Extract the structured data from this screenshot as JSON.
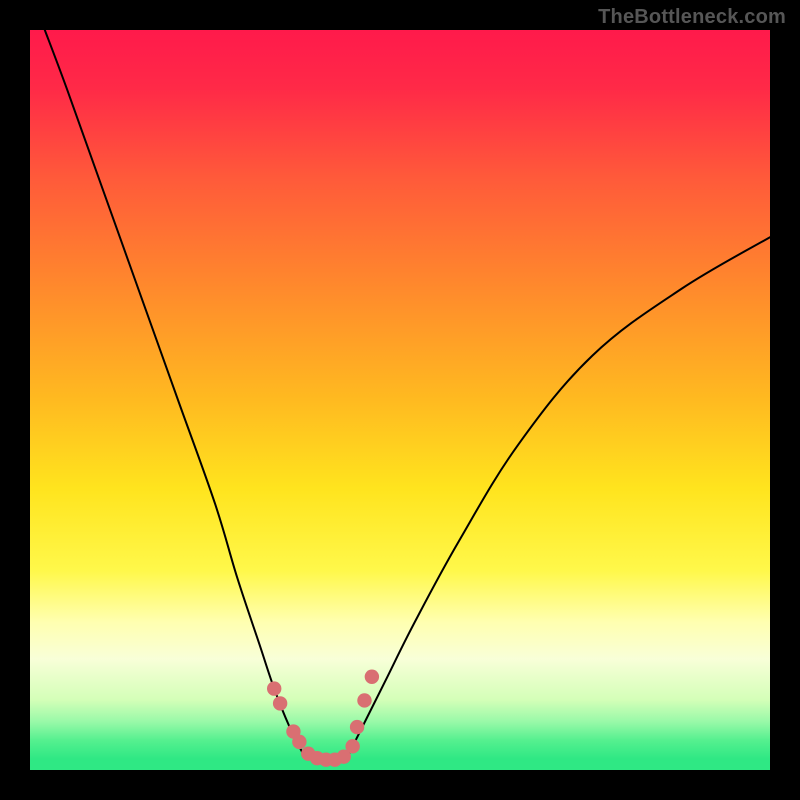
{
  "watermark": {
    "text": "TheBottleneck.com"
  },
  "gradient": {
    "stops": [
      {
        "offset": 0.0,
        "color": "#ff1a4b"
      },
      {
        "offset": 0.08,
        "color": "#ff2a47"
      },
      {
        "offset": 0.2,
        "color": "#ff5a3a"
      },
      {
        "offset": 0.35,
        "color": "#ff8a2c"
      },
      {
        "offset": 0.5,
        "color": "#ffba20"
      },
      {
        "offset": 0.62,
        "color": "#ffe41e"
      },
      {
        "offset": 0.73,
        "color": "#fff84a"
      },
      {
        "offset": 0.8,
        "color": "#ffffb0"
      },
      {
        "offset": 0.85,
        "color": "#f8ffd8"
      },
      {
        "offset": 0.905,
        "color": "#d4ffb8"
      },
      {
        "offset": 0.935,
        "color": "#98f9a8"
      },
      {
        "offset": 0.96,
        "color": "#55f08f"
      },
      {
        "offset": 0.985,
        "color": "#2fe884"
      },
      {
        "offset": 1.0,
        "color": "#2fe884"
      }
    ]
  },
  "chart_data": {
    "type": "line",
    "title": "",
    "xlabel": "",
    "ylabel": "",
    "xlim": [
      0,
      100
    ],
    "ylim": [
      0,
      100
    ],
    "grid": false,
    "series": [
      {
        "name": "left-branch",
        "role": "curve",
        "x": [
          2,
          5,
          10,
          15,
          20,
          25,
          28,
          31,
          33,
          35,
          37
        ],
        "y": [
          100,
          92,
          78,
          64,
          50,
          36,
          26,
          17,
          11,
          6,
          2
        ]
      },
      {
        "name": "right-branch",
        "role": "curve",
        "x": [
          43,
          45,
          48,
          52,
          58,
          66,
          76,
          88,
          100
        ],
        "y": [
          2,
          6,
          12,
          20,
          31,
          44,
          56,
          65,
          72
        ]
      },
      {
        "name": "bottom-flat",
        "role": "curve",
        "x": [
          37,
          39,
          41,
          43
        ],
        "y": [
          2,
          1.5,
          1.5,
          2
        ]
      },
      {
        "name": "left-dots",
        "role": "marker",
        "marker_color": "#d96f72",
        "x": [
          33.0,
          33.8,
          35.6,
          36.4,
          37.6,
          38.8,
          40.0
        ],
        "y": [
          11.0,
          9.0,
          5.2,
          3.8,
          2.2,
          1.6,
          1.4
        ]
      },
      {
        "name": "right-dots",
        "role": "marker",
        "marker_color": "#d96f72",
        "x": [
          41.2,
          42.4,
          43.6,
          44.2,
          45.2,
          46.2
        ],
        "y": [
          1.4,
          1.8,
          3.2,
          5.8,
          9.4,
          12.6
        ]
      }
    ]
  }
}
